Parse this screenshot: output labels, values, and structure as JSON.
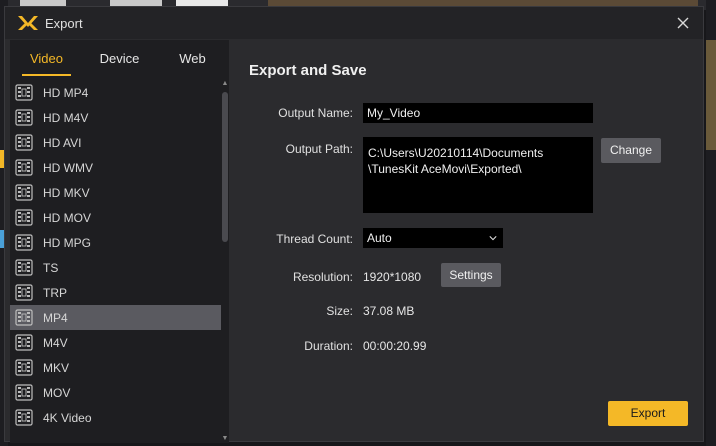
{
  "window": {
    "title": "Export"
  },
  "tabs": [
    {
      "label": "Video",
      "active": true
    },
    {
      "label": "Device",
      "active": false
    },
    {
      "label": "Web",
      "active": false
    }
  ],
  "formats": [
    "HD MP4",
    "HD M4V",
    "HD AVI",
    "HD WMV",
    "HD MKV",
    "HD MOV",
    "HD MPG",
    "TS",
    "TRP",
    "MP4",
    "M4V",
    "MKV",
    "MOV",
    "4K Video"
  ],
  "selected_format": "MP4",
  "panel": {
    "title": "Export and Save",
    "output_name_label": "Output Name:",
    "output_name_value": "My_Video",
    "output_path_label": "Output Path:",
    "output_path_value": "C:\\Users\\U20210114\\Documents\n\\TunesKit AceMovi\\Exported\\",
    "change_label": "Change",
    "thread_count_label": "Thread Count:",
    "thread_count_value": "Auto",
    "resolution_label": "Resolution:",
    "resolution_value": "1920*1080",
    "settings_label": "Settings",
    "size_label": "Size:",
    "size_value": "37.08 MB",
    "duration_label": "Duration:",
    "duration_value": "00:00:20.99",
    "export_label": "Export"
  },
  "colors": {
    "accent": "#f4b827",
    "selected_row": "#5a5a60",
    "dialog_bg": "#2b2b2e"
  }
}
